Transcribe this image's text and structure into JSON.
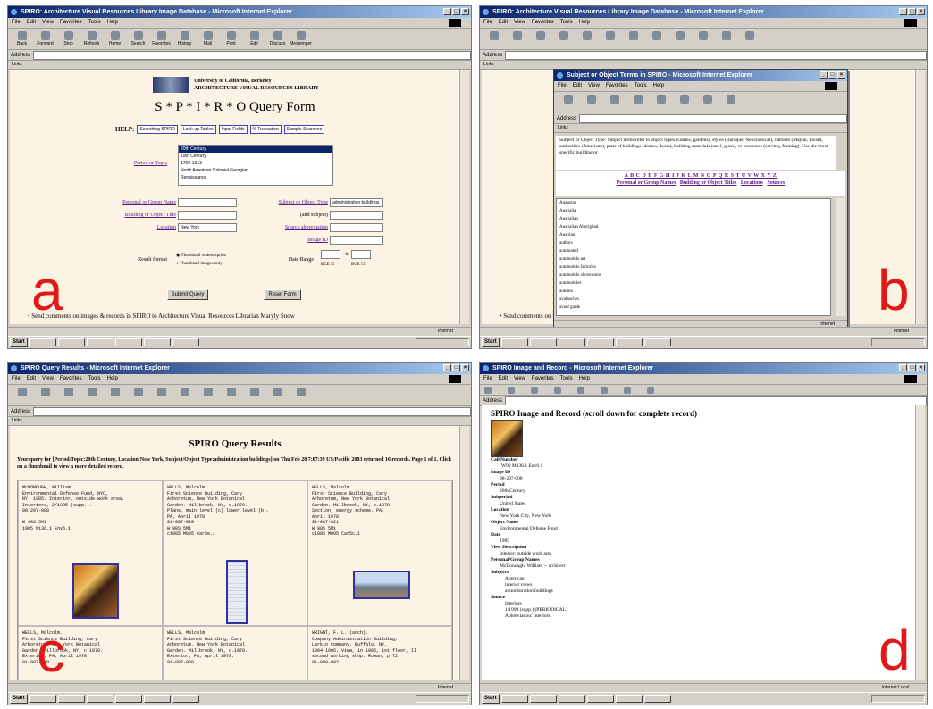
{
  "labels": {
    "a": "a",
    "b": "b",
    "c": "c",
    "d": "d"
  },
  "panel_a": {
    "window_title": "SPIRO: Architecture Visual Resources Library Image Database - Microsoft Internet Explorer",
    "menu": [
      "File",
      "Edit",
      "View",
      "Favorites",
      "Tools",
      "Help"
    ],
    "toolbar": [
      "Back",
      "Forward",
      "Stop",
      "Refresh",
      "Home",
      "Search",
      "Favorites",
      "History",
      "Mail",
      "Print",
      "Edit",
      "Discuss",
      "Messenger"
    ],
    "address_label": "Address",
    "links_label": "Links",
    "institution": "University of California, Berkeley\nARCHITECTURE VISUAL RESOURCES LIBRARY",
    "form_title": "S * P * I * R * O Query Form",
    "help_label": "HELP:",
    "help_buttons": [
      "Searching SPIRO",
      "Look-up Tables",
      "Input Fields",
      "% Truncation",
      "Sample Searches"
    ],
    "period_label": "Period or Topic",
    "period_options": [
      "20th Century",
      "19th Century",
      "1700-1913",
      "North American Colonial Georgian",
      "Renaissance"
    ],
    "personal_label": "Personal or Group Name",
    "subject_label": "Subject or Object Type",
    "subject_value": "administration buildings",
    "and_subject_label": "(and subject)",
    "building_label": "Building or Object Title",
    "source_label": "Source abbreviation",
    "location_label": "Location",
    "location_value": "New York",
    "image_id_label": "Image ID",
    "result_format_label": "Result format",
    "radio_1": "Thumbnail w/description",
    "radio_2": "Thumbnail images only",
    "date_range_label": "Date Range",
    "to_label": "to",
    "bce_1": "BCE",
    "bce_2": "BCE",
    "submit_label": "Submit Query",
    "reset_label": "Reset Form",
    "comment": "Send comments on images & records in SPIRO to Architecture Visual Resources Librarian Maryly Snow",
    "status_right": "Internet",
    "start_label": "Start"
  },
  "panel_b": {
    "popup_title": "Subject or Object Terms in SPIRO - Microsoft Internet Explorer",
    "popup_description": "Subject or Object Type: Subject terms refer to object types (castles, gardens), styles (Baroque, Neoclassical), cultures (Mayan, Incan), authorities (American), parts of buildings (domes, doors), building materials (steel, glass), or processes (carving, framing). Use the most specific building or",
    "alphabet": "A B C D E F G H I J K L M N O P Q R S T U V W X Y Z",
    "popup_links": [
      "Personal or Group Names",
      "Building or Object Titles",
      "Locations",
      "Sources"
    ],
    "terms": [
      "Augustan",
      "Australia",
      "Australian",
      "Australian Aboriginal",
      "Austrian",
      "authors",
      "automated",
      "automobile art",
      "automobile factories",
      "automobile showrooms",
      "automobiles",
      "autumn",
      "avalanches",
      "avant garde"
    ],
    "status_right": "Internet",
    "comment": "Send comments on images & records in SPIRO to Architecture Visual Resources Librarian Maryly Snow"
  },
  "panel_c": {
    "window_title": "SPIRO Query Results - Microsoft Internet Explorer",
    "results_title": "SPIRO Query Results",
    "results_desc": "Your query for [Period/Topic:20th Century, Location:New York, Subject/Object Type:administration buildings] on Thu Feb 28 7:07:39 US/Pacific 2003 returned 16 records. Page 1 of 1. Click on a thumbnail to view a more detailed record.",
    "cells": [
      "McDONOUGH, William.\nEnvironmental Defense Fund, NYC,\nNY. 1985. Interior, outside work area.\nInteriors, 2/1985 (supp.).\n98-297-008\n\nW 90S 5M1\n1985 M136.1 Env6.1",
      "WELLS, Malcolm.\nFirst Science Building, Cary\nArboretum, New York Botanical\nGarden. Millbrook, NY, c.1970.\nPlans, main level (c) lower level (b).\nPA, April 1978.\n91-087-028\nW 90S 5M1\nc1985 M005 Car5e.1",
      "WELLS, Malcolm.\nFirst Science Building, Cary\nArboretum, New York Botanical\nGarden. Millbrook, NY, c.1970.\nSection, energy scheme. PA,\nApril 1978.\n91-087-021\nW 90S 5M1\nc1985 M005 Car5c.1",
      "WELLS, Malcolm.\nFirst Science Building, Cary\nArboretum, New York Botanical\nGarden. Millbrook, NY, c.1970.\nExterior, PA, April 1978.\n91-087-019",
      "WELLS, Malcolm.\nFirst Science Building, Cary\nArboretum, New York Botanical\nGarden. Millbrook, NY, c.1970.\nExterior, PA, April 1978.\n91-087-020",
      "WRIGHT, F. L. (arch).\nCompany Administration Building,\nLarkin Company, Buffalo, NY.\n1904-1906. View, in 1906, 1st floor, II\nsecond working shop. Rowan, p.72.\n91-080-002"
    ],
    "start_label": "Start"
  },
  "panel_d": {
    "window_title": "SPIRO Image and Record - Microsoft Internet Explorer",
    "record_title": "SPIRO Image and Record (scroll down for complete record)",
    "fields": [
      {
        "k": "Call Number",
        "v": "(W90 M136.1 Env6.1"
      },
      {
        "k": "Image ID",
        "v": "98-297-008"
      },
      {
        "k": "Period",
        "v": "20th Century"
      },
      {
        "k": "Subperiod",
        "v": "United States"
      },
      {
        "k": "Location",
        "v": "New York City, New York"
      },
      {
        "k": "Object Name",
        "v": "Environmental Defense Fund"
      },
      {
        "k": "Date",
        "v": "1985"
      },
      {
        "k": "View Description",
        "v": "Interior: outside work area"
      },
      {
        "k": "Personal/Group Names",
        "v": "McDonough, William -- architect"
      },
      {
        "k": "Subjects",
        "v": ""
      },
      {
        "k": "",
        "v": "American",
        "sub": true
      },
      {
        "k": "",
        "v": "interior views",
        "sub": true
      },
      {
        "k": "",
        "v": "administration buildings",
        "sub": true
      },
      {
        "k": "Source",
        "v": ""
      },
      {
        "k": "",
        "v": "Interiors",
        "sub": true
      },
      {
        "k": "",
        "v": "1/1999 (supp.) (PERIODICAL)",
        "sub": true
      },
      {
        "k": "",
        "v": "Abbreviation: Interiors",
        "sub": true
      }
    ],
    "status_right": "Internet Local"
  }
}
